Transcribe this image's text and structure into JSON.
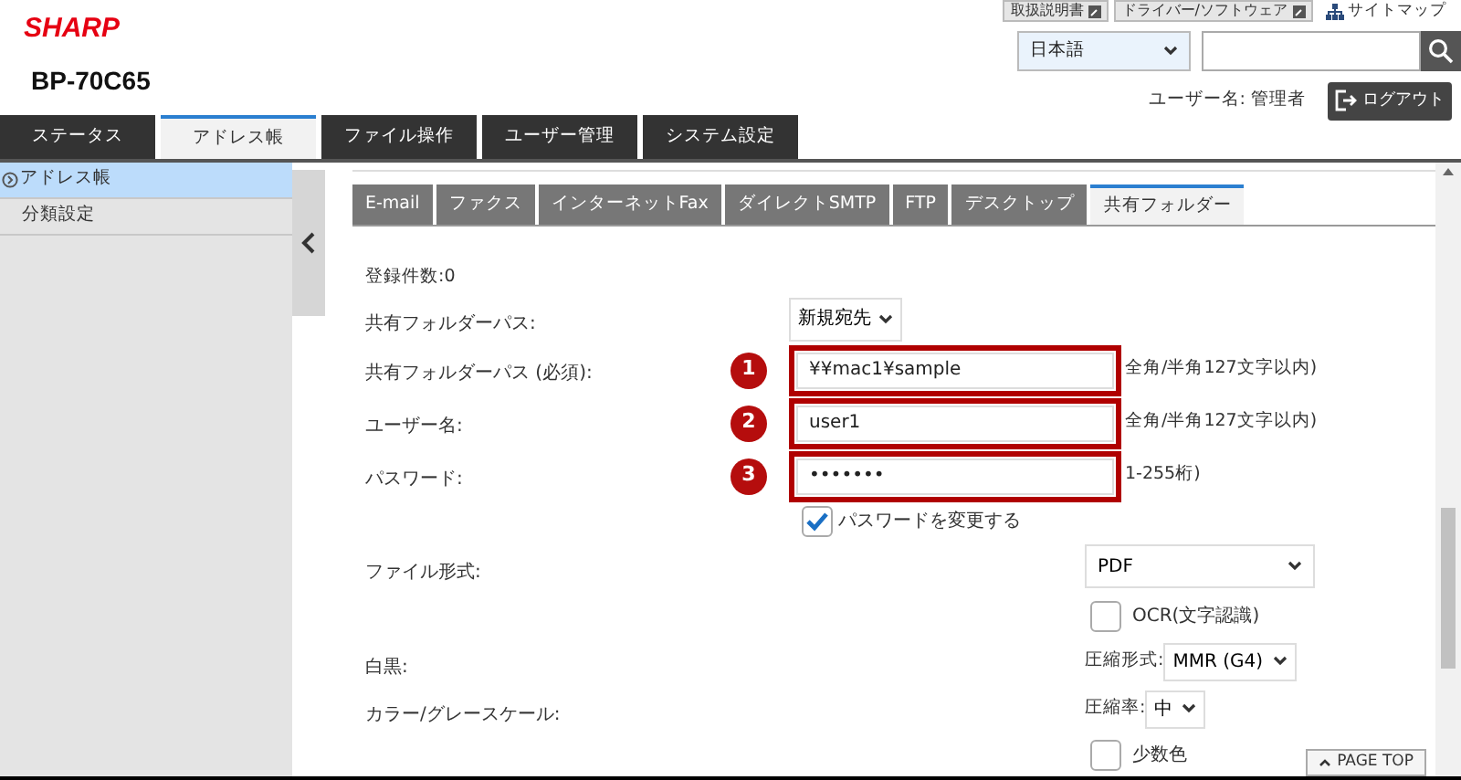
{
  "header": {
    "logo": "SHARP",
    "model": "BP-70C65",
    "links": [
      {
        "label": "取扱説明書"
      },
      {
        "label": "ドライバー/ソフトウェア"
      }
    ],
    "sitemap": "サイトマップ",
    "language": "日本語",
    "user_label": "ユーザー名: 管理者",
    "logout": "ログアウト"
  },
  "main_tabs": [
    {
      "label": "ステータス",
      "selected": false
    },
    {
      "label": "アドレス帳",
      "selected": true
    },
    {
      "label": "ファイル操作",
      "selected": false
    },
    {
      "label": "ユーザー管理",
      "selected": false
    },
    {
      "label": "システム設定",
      "selected": false
    }
  ],
  "sidebar": {
    "items": [
      {
        "label": "アドレス帳",
        "selected": true
      },
      {
        "label": "分類設定",
        "selected": false
      }
    ]
  },
  "sub_tabs": [
    {
      "label": "E-mail",
      "selected": false
    },
    {
      "label": "ファクス",
      "selected": false
    },
    {
      "label": "インターネットFax",
      "selected": false
    },
    {
      "label": "ダイレクトSMTP",
      "selected": false
    },
    {
      "label": "FTP",
      "selected": false
    },
    {
      "label": "デスクトップ",
      "selected": false
    },
    {
      "label": "共有フォルダー",
      "selected": true
    }
  ],
  "count": "登録件数:0",
  "form": [
    {
      "kind": "select",
      "label": "共有フォルダーパス:",
      "value": "新規宛先"
    },
    {
      "kind": "text",
      "label": "共有フォルダーパス (必須):",
      "value": "¥¥mac1¥sample",
      "marker": "1",
      "hint": "全角/半角127文字以内)"
    },
    {
      "kind": "text",
      "label": "ユーザー名:",
      "value": "user1",
      "marker": "2",
      "hint": "全角/半角127文字以内)"
    },
    {
      "kind": "text",
      "label": "パスワード:",
      "value": "•••••••",
      "marker": "3",
      "hint": "1-255桁)"
    },
    {
      "kind": "checkbox",
      "label": "パスワードを変更する",
      "checked": true
    },
    {
      "kind": "wide_select",
      "label": "ファイル形式:",
      "value": "PDF"
    },
    {
      "kind": "sub_checkbox",
      "label": "OCR(文字認識)",
      "checked": false
    },
    {
      "kind": "captioned_select",
      "label": "白黒:",
      "caption": "圧縮形式:",
      "value": "MMR (G4)"
    },
    {
      "kind": "captioned_select",
      "label": "カラー/グレースケール:",
      "caption": "圧縮率:",
      "value": "中"
    },
    {
      "kind": "sub_checkbox",
      "label": "少数色",
      "checked": false
    }
  ],
  "page_top": "PAGE TOP"
}
